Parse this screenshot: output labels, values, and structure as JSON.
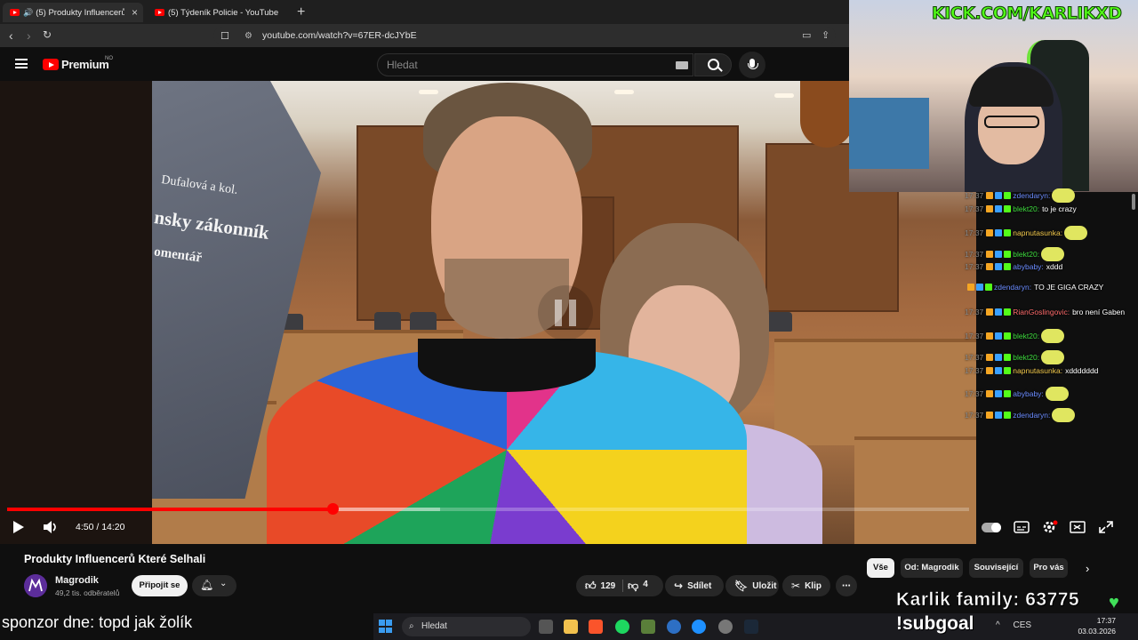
{
  "browser": {
    "tabs": [
      {
        "title": "(5) Produkty Influencerů Které...",
        "active": true
      },
      {
        "title": "(5) Týdeník Policie - YouTube",
        "active": false
      }
    ],
    "url": "youtube.com/watch?v=67ER-dcJYbE"
  },
  "youtube": {
    "brand": "Premium",
    "region": "NO",
    "search_placeholder": "Hledat"
  },
  "video": {
    "book_text": {
      "line1": "Dufalová a kol.",
      "line2": "nsky zákonník",
      "line3": "omentář"
    },
    "time": "4:50 / 14:20",
    "played_fraction": 0.338,
    "buffered_fraction": 0.45
  },
  "details": {
    "title": "Produkty Influencerů Které Selhali",
    "channel": "Magrodik",
    "subscribers": "49,2 tis. odběratelů",
    "join_label": "Připojit se",
    "likes": "129",
    "dislikes": "4",
    "share_label": "Sdílet",
    "save_label": "Uložit",
    "clip_label": "Klip"
  },
  "chips": [
    "Vše",
    "Od: Magrodik",
    "Související",
    "Pro vás"
  ],
  "overlay": {
    "kick_url": "KICK.COM/KARLIKXD",
    "family_count": "Karlik family: 63775",
    "sponsor": "sponzor dne: topd jak žolík",
    "subgoal": "!subgoal"
  },
  "chat": [
    {
      "time": "17:37",
      "user": "zdendaryn:",
      "color": "#6b8cff",
      "text": ""
    },
    {
      "time": "17:37",
      "user": "blekt20:",
      "color": "#3fdc3f",
      "text": "to je crazy"
    },
    {
      "time": "17:37",
      "user": "napnutasunka:",
      "color": "#f2c94c",
      "text": ""
    },
    {
      "time": "17:37",
      "user": "blekt20:",
      "color": "#3fdc3f",
      "text": ""
    },
    {
      "time": "17:37",
      "user": "abybaby:",
      "color": "#6b8cff",
      "text": "xddd"
    },
    {
      "time": "",
      "user": "zdendaryn:",
      "color": "#6b8cff",
      "text": "TO JE GIGA CRAZY"
    },
    {
      "time": "17:37",
      "user": "RianGoslingovic:",
      "color": "#ff6b6b",
      "text": "bro není Gaben"
    },
    {
      "time": "17:37",
      "user": "blekt20:",
      "color": "#3fdc3f",
      "text": ""
    },
    {
      "time": "17:37",
      "user": "blekt20:",
      "color": "#3fdc3f",
      "text": ""
    },
    {
      "time": "17:37",
      "user": "napnutasunka:",
      "color": "#f2c94c",
      "text": "xddddddd"
    },
    {
      "time": "17:37",
      "user": "abybaby:",
      "color": "#6b8cff",
      "text": ""
    },
    {
      "time": "17:37",
      "user": "zdendaryn:",
      "color": "#6b8cff",
      "text": ""
    }
  ],
  "taskbar": {
    "search_label": "Hledat",
    "language": "CES",
    "time": "17:37",
    "date": "03.03.2026"
  },
  "icons": {
    "play": "play-icon",
    "volume": "volume-icon",
    "like": "thumb-up-icon",
    "dislike": "thumb-down-icon",
    "share": "share-icon",
    "save": "bookmark-icon",
    "clip": "scissors-icon",
    "bell": "bell-icon"
  }
}
